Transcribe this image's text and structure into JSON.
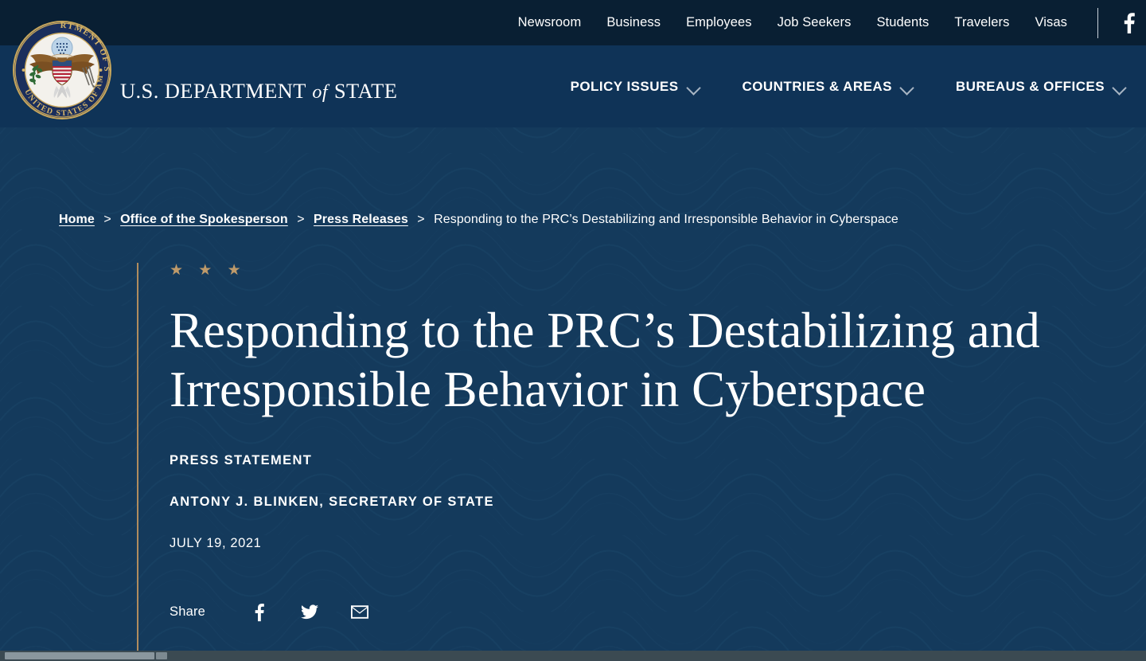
{
  "site": {
    "seal_alt": "department-of-state-seal",
    "wordmark_prefix": "U.S. DEPARTMENT",
    "wordmark_of": "of",
    "wordmark_suffix": "STATE",
    "colors": {
      "utility_bar": "#091F33",
      "header": "#0F3357",
      "hero_background": "#143A5C",
      "accent_gold": "#B08C5E",
      "star_gold": "#BE9A6A",
      "text": "#FFFFFF"
    }
  },
  "utility_nav": {
    "items": [
      {
        "label": "Newsroom"
      },
      {
        "label": "Business"
      },
      {
        "label": "Employees"
      },
      {
        "label": "Job Seekers"
      },
      {
        "label": "Students"
      },
      {
        "label": "Travelers"
      },
      {
        "label": "Visas"
      }
    ],
    "social": {
      "icon": "facebook-icon"
    }
  },
  "main_nav": {
    "items": [
      {
        "label": "POLICY ISSUES",
        "icon": "chevron-down-icon"
      },
      {
        "label": "COUNTRIES & AREAS",
        "icon": "chevron-down-icon"
      },
      {
        "label": "BUREAUS & OFFICES",
        "icon": "chevron-down-icon"
      }
    ]
  },
  "breadcrumb": {
    "items": [
      {
        "label": "Home",
        "is_link": true
      },
      {
        "label": "Office of the Spokesperson",
        "is_link": true
      },
      {
        "label": "Press Releases",
        "is_link": true
      },
      {
        "label": "Responding to the PRC’s Destabilizing and Irresponsible Behavior in Cyberspace",
        "is_link": false
      }
    ],
    "separator": ">"
  },
  "article": {
    "stars": "★ ★ ★",
    "title": "Responding to the PRC’s Destabilizing and Irresponsible Behavior in Cyberspace",
    "kicker": "PRESS STATEMENT",
    "author": "ANTONY J. BLINKEN, SECRETARY OF STATE",
    "date": "JULY 19, 2021"
  },
  "share": {
    "label": "Share",
    "buttons": [
      {
        "icon": "facebook-icon",
        "name": "share-facebook-button"
      },
      {
        "icon": "twitter-icon",
        "name": "share-twitter-button"
      },
      {
        "icon": "email-icon",
        "name": "share-email-button"
      }
    ]
  },
  "scrollbar": {
    "orientation": "horizontal",
    "position": "bottom"
  }
}
